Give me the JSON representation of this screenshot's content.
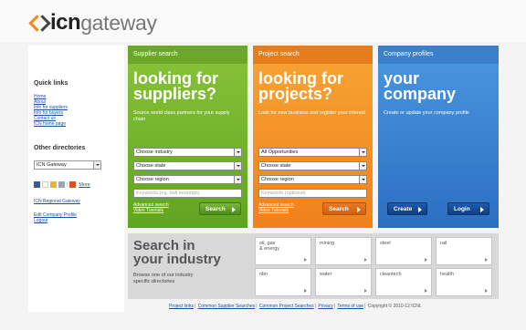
{
  "brand": {
    "bold": "icn",
    "light": "gateway"
  },
  "sidebar": {
    "quick_title": "Quick links",
    "quick_links": [
      "Home",
      "About",
      "Info for suppliers",
      "Info for buyers",
      "Contact us",
      "ICN home page"
    ],
    "other_title": "Other directories",
    "directory_selected": "ICN Gateway",
    "share_more": "More",
    "regional": "ICN Regional Gateway",
    "edit_profile": "Edit Company Profile",
    "logout": "Logout"
  },
  "supplier": {
    "header": "Supplier search",
    "big_line1": "looking for",
    "big_line2": "suppliers?",
    "sub": "Source world class partners for your supply chain",
    "industry": "Choose industry",
    "state": "Choose state",
    "region": "Choose region",
    "keywords_placeholder": "Keywords (eg. ball bearings)",
    "advanced": "Advanced search",
    "tutorials": "Video Tutorials",
    "button": "Search"
  },
  "project": {
    "header": "Project search",
    "big_line1": "looking for",
    "big_line2": "projects?",
    "sub": "Look for new business and register your interest",
    "opportunities": "All Opportunities",
    "state": "Choose state",
    "region": "Choose region",
    "keywords_placeholder": "Keywords (optional)",
    "advanced": "Advanced search",
    "tutorials": "Video Tutorials",
    "button": "Search"
  },
  "company": {
    "header": "Company profiles",
    "big_line1": "your",
    "big_line2": "company",
    "sub": "Create or update your company profile",
    "create": "Create",
    "login": "Login"
  },
  "industry": {
    "title_line1": "Search in",
    "title_line2": "your industry",
    "sub_line1": "Browse one of our industry",
    "sub_line2": "specific directories",
    "tiles": [
      {
        "line1": "oil, gas",
        "line2": "& energy"
      },
      {
        "line1": "mining",
        "line2": ""
      },
      {
        "line1": "steel",
        "line2": ""
      },
      {
        "line1": "rail",
        "line2": ""
      },
      {
        "line1": "nbn",
        "line2": ""
      },
      {
        "line1": "water",
        "line2": ""
      },
      {
        "line1": "cleantech",
        "line2": ""
      },
      {
        "line1": "health",
        "line2": ""
      }
    ]
  },
  "footer": {
    "links": [
      "Project links",
      "Common Supplier Searches",
      "Common Project Searches",
      "Privacy",
      "Terms of use"
    ],
    "copyright": "Copyright © 2010-12 ICNL"
  }
}
